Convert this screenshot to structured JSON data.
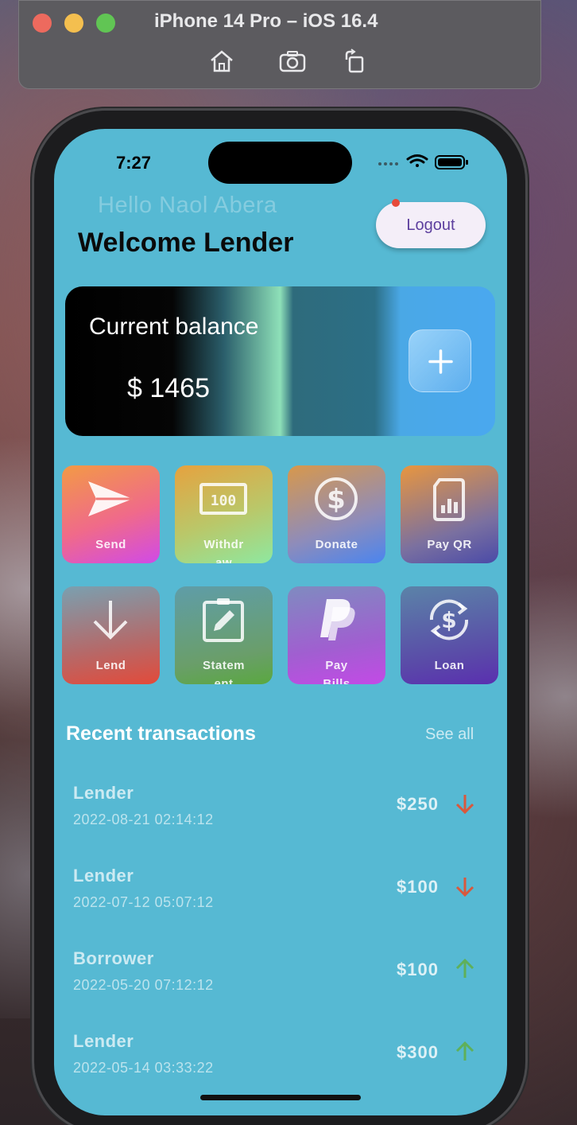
{
  "simulator": {
    "title": "iPhone 14 Pro – iOS 16.4",
    "icons": [
      "home-icon",
      "screenshot-icon",
      "rotate-icon"
    ]
  },
  "status_bar": {
    "time": "7:27"
  },
  "header": {
    "greeting": "Hello Naol Abera",
    "title": "Welcome Lender",
    "logout_label": "Logout"
  },
  "balance_card": {
    "label": "Current balance",
    "value": "$ 1465",
    "add_icon": "plus-icon"
  },
  "actions": [
    {
      "label": "Send",
      "icon": "send-icon"
    },
    {
      "label": "Withdr\naw",
      "icon": "cash-100-icon"
    },
    {
      "label": "Donate",
      "icon": "dollar-circle-icon"
    },
    {
      "label": "Pay QR",
      "icon": "sim-card-icon"
    },
    {
      "label": "Lend",
      "icon": "arrow-down-icon"
    },
    {
      "label": "Statem\nent",
      "icon": "clipboard-edit-icon"
    },
    {
      "label": "Pay\nBills",
      "icon": "paypal-icon"
    },
    {
      "label": "Loan",
      "icon": "currency-exchange-icon"
    }
  ],
  "transactions": {
    "title": "Recent transactions",
    "see_all": "See all",
    "items": [
      {
        "name": "Lender",
        "date": "2022-08-21 02:14:12",
        "amount": "$250",
        "direction": "down",
        "color": "#d9583c"
      },
      {
        "name": "Lender",
        "date": "2022-07-12 05:07:12",
        "amount": "$100",
        "direction": "down",
        "color": "#d9583c"
      },
      {
        "name": "Borrower",
        "date": "2022-05-20 07:12:12",
        "amount": "$100",
        "direction": "up",
        "color": "#5fb05a"
      },
      {
        "name": "Lender",
        "date": "2022-05-14 03:33:22",
        "amount": "$300",
        "direction": "up",
        "color": "#5fb05a"
      }
    ]
  },
  "colors": {
    "screen_bg": "#56b9d3",
    "logout_text": "#5d3f9e",
    "down": "#d9583c",
    "up": "#5fb05a"
  }
}
